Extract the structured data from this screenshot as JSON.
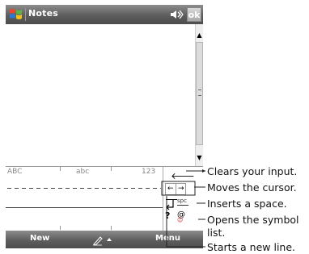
{
  "titlebar": {
    "app_title": "Notes",
    "ok_label": "ok"
  },
  "keyboard": {
    "label_upper": "ABC",
    "label_lower": "abc",
    "label_numbers": "123",
    "space_label": "spc"
  },
  "menubar": {
    "left_label": "New",
    "right_label": "Menu"
  },
  "callouts": {
    "clear_input": "Clears your input.",
    "move_cursor": "Moves the cursor.",
    "insert_space": "Inserts a space.",
    "symbol_line1": "Opens the symbol",
    "symbol_line2": "list.",
    "new_line": "Starts a new line."
  },
  "colors": {
    "bar_dark": "#4d4d4d",
    "bar_light": "#8d8d8d",
    "ok_button": "#b5b5b5"
  },
  "icons": {
    "start": "windows-flag-icon",
    "volume": "speaker-icon",
    "input_panel": "pen-input-icon"
  }
}
